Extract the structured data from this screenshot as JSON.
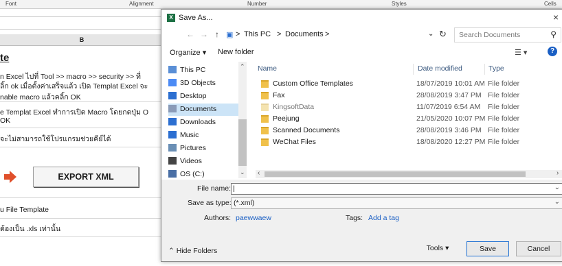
{
  "excel": {
    "ribbon": {
      "font": "Font",
      "alignment": "Alignment",
      "number": "Number",
      "styles": "Styles",
      "cells": "Cells"
    },
    "column_b": "B",
    "title": "te",
    "lines": [
      "n Excel ไปที่ Tool >> macro >> security >> ที่",
      "ลิ้ก ok เมื่อตั้งค่าเสร็จแล้ว เปิด Templat Excel จะ",
      "nable macro แล้วคลิ้ก OK",
      "e Templat Excel ทำการเปิด Macro โดยกดปุ่ม O",
      "OK",
      "จะไม่สามารถใช้โปรแกรมช่วยคีย์ได้",
      "u File Template",
      "ต้องเป็น .xls เท่านั้น"
    ],
    "export_button": "EXPORT XML"
  },
  "dialog": {
    "title": "Save As...",
    "xl_icon": "X",
    "close": "×",
    "address": {
      "back": "←",
      "forward": "→",
      "up": "↑",
      "crumbs": [
        "This PC",
        "Documents"
      ],
      "sep": ">",
      "dropdown": "⌄",
      "refresh": "↻",
      "search_placeholder": "Search Documents",
      "search_icon": "⚲"
    },
    "toolbar": {
      "organize": "Organize ▾",
      "new_folder": "New folder",
      "view": "☰ ▾",
      "help": "?"
    },
    "nav": [
      {
        "label": "This PC",
        "icon": "pc-icon",
        "color": "#5a8fd6"
      },
      {
        "label": "3D Objects",
        "icon": "cube-icon",
        "color": "#4c8bf5"
      },
      {
        "label": "Desktop",
        "icon": "desktop-icon",
        "color": "#2c6fd1"
      },
      {
        "label": "Documents",
        "icon": "documents-icon",
        "color": "#8a9bb8"
      },
      {
        "label": "Downloads",
        "icon": "download-icon",
        "color": "#2c6fd1"
      },
      {
        "label": "Music",
        "icon": "music-icon",
        "color": "#2c6fd1"
      },
      {
        "label": "Pictures",
        "icon": "pictures-icon",
        "color": "#6a8fb5"
      },
      {
        "label": "Videos",
        "icon": "videos-icon",
        "color": "#444"
      },
      {
        "label": "OS (C:)",
        "icon": "drive-icon",
        "color": "#4a6fa5"
      }
    ],
    "columns": {
      "name": "Name",
      "date": "Date modified",
      "type": "Type"
    },
    "files": [
      {
        "name": "Custom Office Templates",
        "date": "18/07/2019 10:01 AM",
        "type": "File folder",
        "faded": false
      },
      {
        "name": "Fax",
        "date": "28/08/2019 3:47 PM",
        "type": "File folder",
        "faded": false
      },
      {
        "name": "KingsoftData",
        "date": "11/07/2019 6:54 AM",
        "type": "File folder",
        "faded": true
      },
      {
        "name": "Peejung",
        "date": "21/05/2020 10:07 PM",
        "type": "File folder",
        "faded": false
      },
      {
        "name": "Scanned Documents",
        "date": "28/08/2019 3:46 PM",
        "type": "File folder",
        "faded": false
      },
      {
        "name": "WeChat Files",
        "date": "18/08/2020 12:27 PM",
        "type": "File folder",
        "faded": false
      }
    ],
    "form": {
      "file_name_label": "File name:",
      "file_name_value": "",
      "save_type_label": "Save as type:",
      "save_type_value": "(*.xml)",
      "authors_label": "Authors:",
      "authors_value": "paewwaew",
      "tags_label": "Tags:",
      "tags_value": "Add a tag"
    },
    "footer": {
      "hide_folders": "⌃ Hide Folders",
      "tools": "Tools ▾",
      "save": "Save",
      "cancel": "Cancel"
    }
  }
}
